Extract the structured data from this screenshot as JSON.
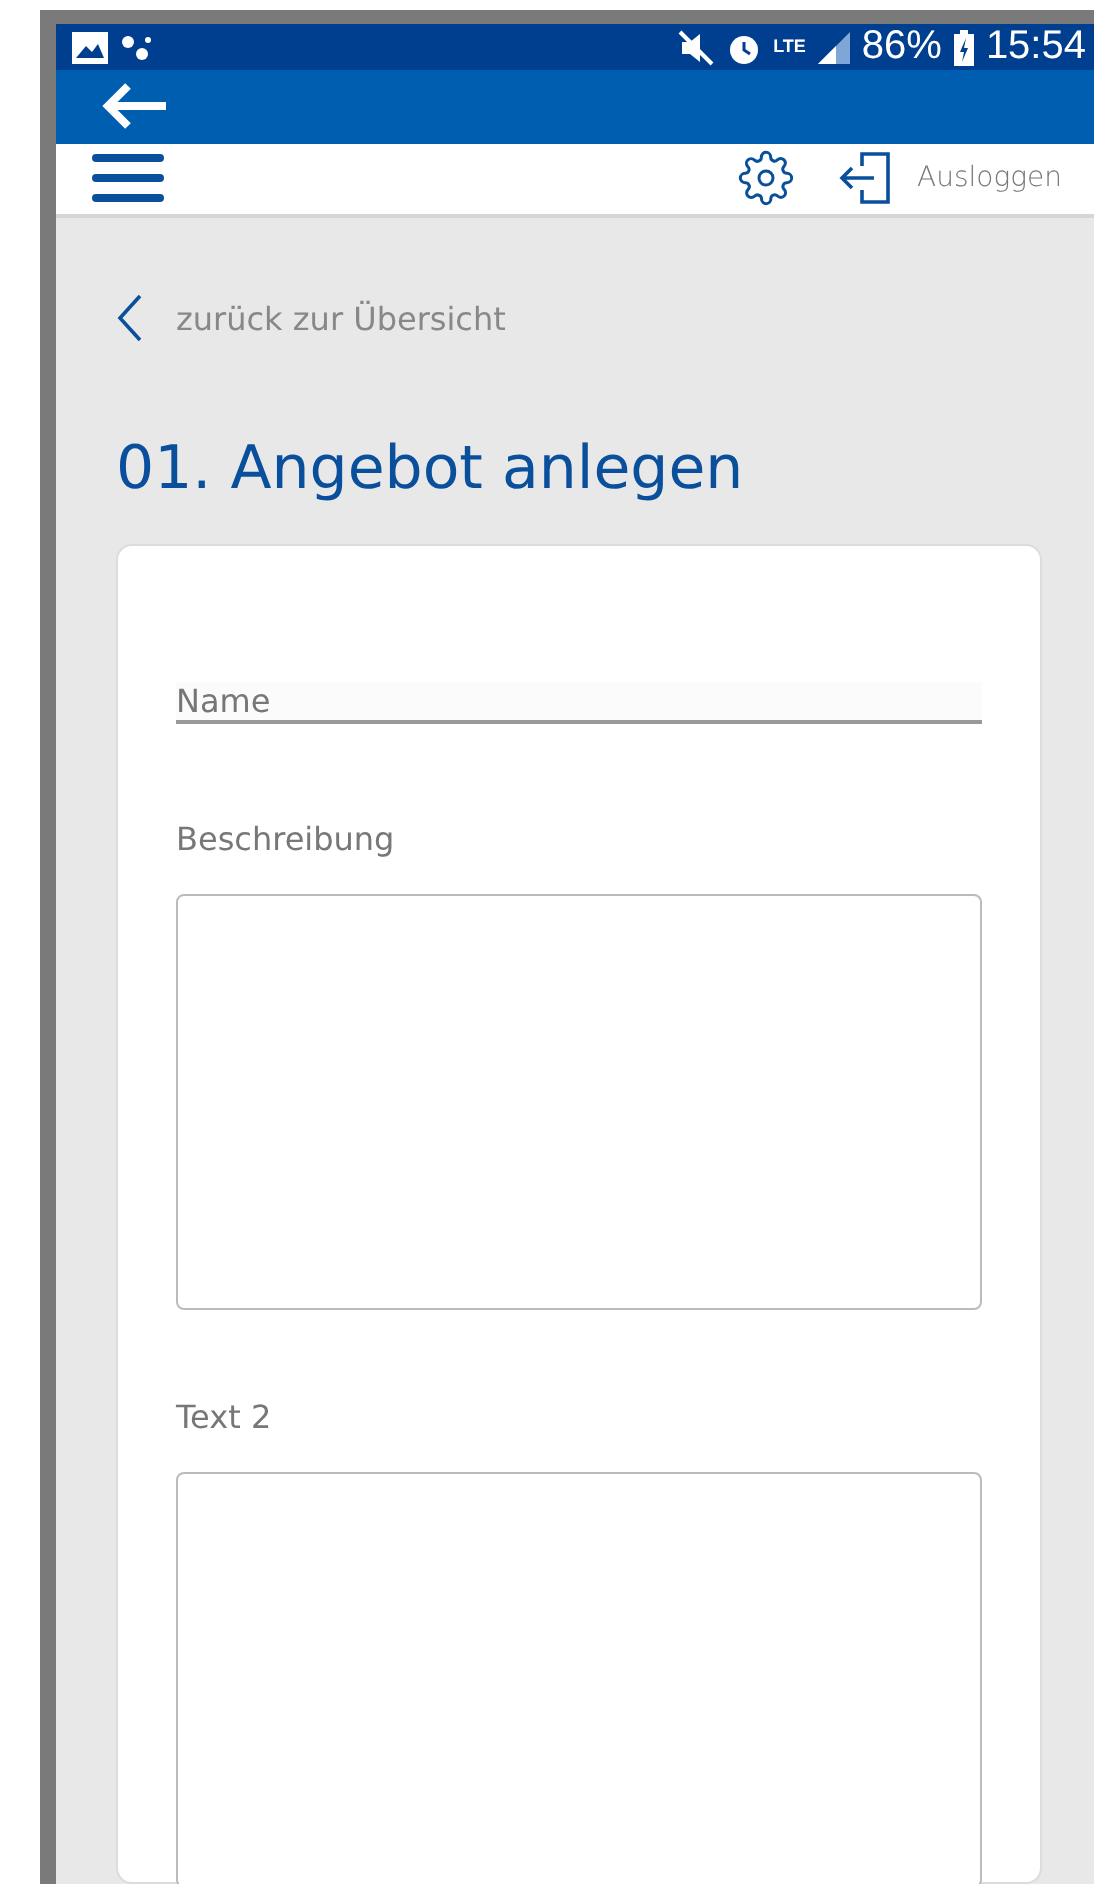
{
  "status_bar": {
    "network": "LTE",
    "battery": "86%",
    "time": "15:54"
  },
  "toolbar": {
    "logout": "Ausloggen"
  },
  "back_link": "zurück zur Übersicht",
  "title": "01. Angebot anlegen",
  "form": {
    "fields": [
      {
        "kind": "input",
        "placeholder": "Name"
      },
      {
        "kind": "textarea",
        "label": "Beschreibung"
      },
      {
        "kind": "textarea",
        "label": "Text 2"
      }
    ]
  }
}
